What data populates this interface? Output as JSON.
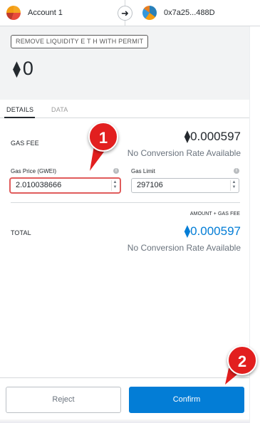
{
  "header": {
    "from_account": "Account 1",
    "to_address": "0x7a25...488D",
    "arrow_icon": "arrow-right-icon"
  },
  "summary": {
    "method": "REMOVE LIQUIDITY E T H WITH PERMIT",
    "currency_symbol": "⧫",
    "amount": "0"
  },
  "tabs": {
    "details": "DETAILS",
    "data": "DATA"
  },
  "details": {
    "gas_fee_label": "GAS FEE",
    "gas_fee_value": "⧫0.000597",
    "gas_fee_conversion": "No Conversion Rate Available",
    "gas_price_label": "Gas Price (GWEI)",
    "gas_price_value": "2.010038666",
    "gas_limit_label": "Gas Limit",
    "gas_limit_value": "297106",
    "amount_gas_label": "AMOUNT + GAS FEE",
    "total_label": "TOTAL",
    "total_value": "⧫0.000597",
    "total_conversion": "No Conversion Rate Available"
  },
  "footer": {
    "reject_label": "Reject",
    "confirm_label": "Confirm"
  },
  "annotations": {
    "marker_1": "1",
    "marker_2": "2",
    "marker_color": "#e21f1f"
  },
  "colors": {
    "accent": "#037dd6",
    "error": "#e05c5c"
  }
}
